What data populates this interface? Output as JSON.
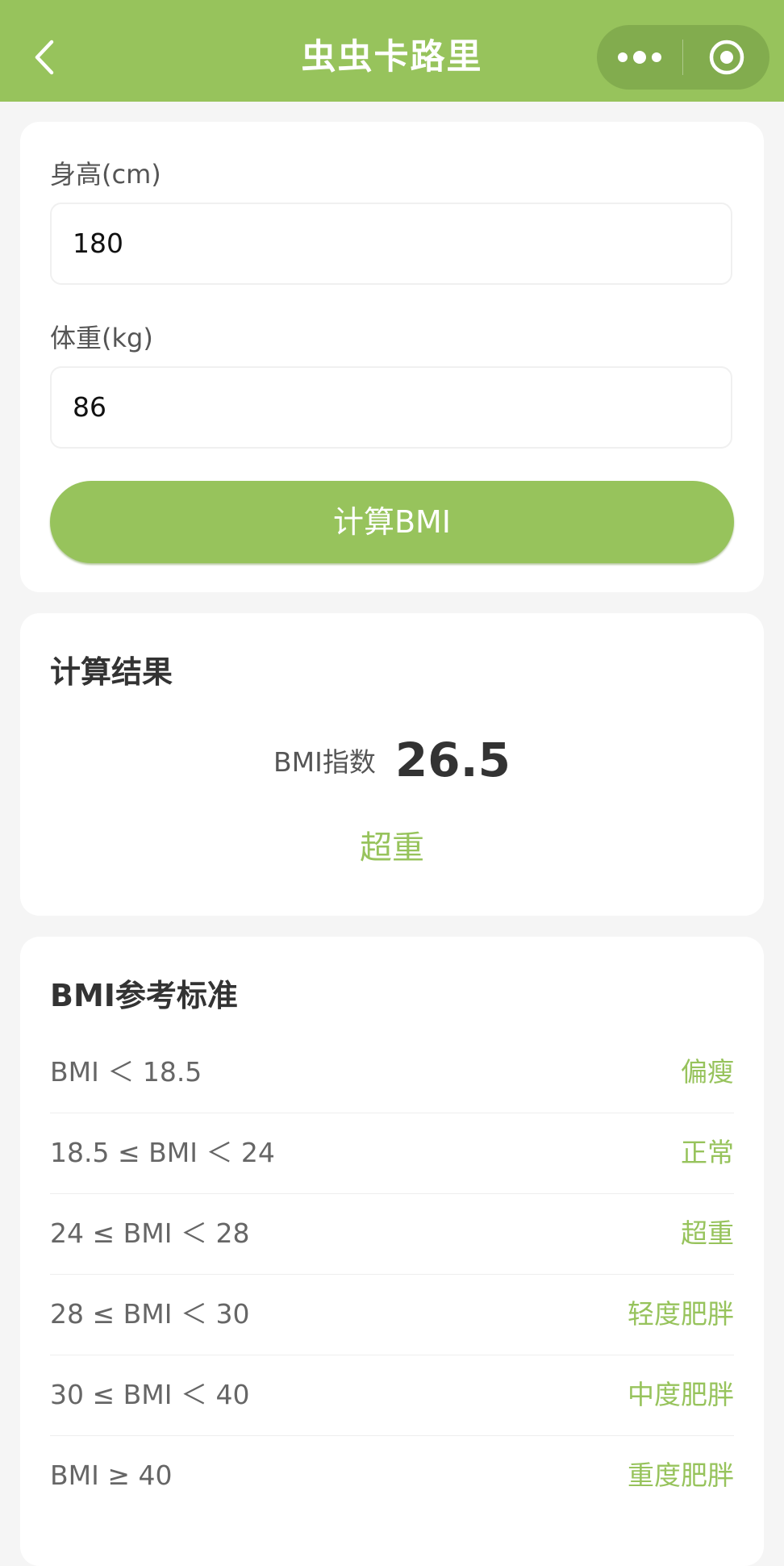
{
  "navbar": {
    "title": "虫虫卡路里",
    "accent": "#97c35c"
  },
  "form": {
    "height_label": "身高(cm)",
    "height_value": "180",
    "weight_label": "体重(kg)",
    "weight_value": "86",
    "calc_button": "计算BMI"
  },
  "result": {
    "title": "计算结果",
    "bmi_label": "BMI指数",
    "bmi_value": "26.5",
    "status": "超重"
  },
  "reference": {
    "title": "BMI参考标准",
    "rows": [
      {
        "range": "BMI ＜ 18.5",
        "category": "偏瘦"
      },
      {
        "range": "18.5 ≤ BMI ＜ 24",
        "category": "正常"
      },
      {
        "range": "24 ≤ BMI ＜ 28",
        "category": "超重"
      },
      {
        "range": "28 ≤ BMI ＜ 30",
        "category": "轻度肥胖"
      },
      {
        "range": "30 ≤ BMI ＜ 40",
        "category": "中度肥胖"
      },
      {
        "range": "BMI ≥ 40",
        "category": "重度肥胖"
      }
    ]
  },
  "icons": [
    "chevron-left-icon",
    "more-dots-icon",
    "target-icon"
  ]
}
